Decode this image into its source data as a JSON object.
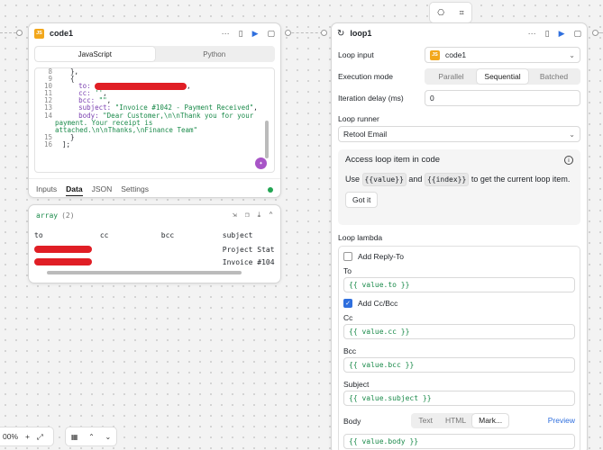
{
  "code_card": {
    "title": "code1",
    "badge": "JS",
    "tabs": [
      "JavaScript",
      "Python"
    ],
    "lines": [
      "8",
      "9",
      "10",
      "11",
      "12",
      "13",
      "14",
      "",
      "",
      "15",
      "16"
    ],
    "code": {
      "l8": "  },",
      "l9": "  {",
      "to_key": "to:",
      "to_tail": ",",
      "cc_key": "cc:",
      "cc_val": "''",
      "cc_tail": ",",
      "bcc_key": "bcc:",
      "bcc_val": "\"\"",
      "bcc_tail": ",",
      "subject_key": "subject:",
      "subject_val": "\"Invoice #1042 - Payment Received\"",
      "subject_tail": ",",
      "body_key": "body:",
      "body_val1": "\"Dear Customer,\\n\\nThank you for your",
      "body_val2": "payment. Your receipt is",
      "body_val3": "attached.\\n\\nThanks,\\nFinance Team\"",
      "l15": "  }",
      "l16": "];"
    },
    "subtabs": [
      "Inputs",
      "Data",
      "JSON",
      "Settings"
    ]
  },
  "result_card": {
    "label": "array",
    "count": "(2)",
    "columns": [
      "to",
      "cc",
      "bcc",
      "subject"
    ],
    "rows": [
      {
        "subject": "Project Stat"
      },
      {
        "subject": "Invoice #104"
      }
    ]
  },
  "loop_card": {
    "title": "loop1",
    "loop_input_label": "Loop input",
    "loop_input_value": "code1",
    "execution_mode_label": "Execution mode",
    "execution_modes": [
      "Parallel",
      "Sequential",
      "Batched"
    ],
    "iteration_delay_label": "Iteration delay (ms)",
    "iteration_delay_value": "0",
    "loop_runner_label": "Loop runner",
    "loop_runner_value": "Retool Email",
    "info": {
      "title": "Access loop item in code",
      "use": "Use",
      "pill1": "{{value}}",
      "and": "and",
      "pill2": "{{index}}",
      "rest": "to get the current loop item.",
      "button": "Got it"
    },
    "lambda_label": "Loop lambda",
    "add_reply_to": "Add Reply-To",
    "to_label": "To",
    "to_expr": "value.to",
    "add_cc_bcc": "Add Cc/Bcc",
    "cc_label": "Cc",
    "cc_expr": "value.cc",
    "bcc_label": "Bcc",
    "bcc_expr": "value.bcc",
    "subject_label": "Subject",
    "subject_expr": "value.subject",
    "body_label": "Body",
    "body_modes": [
      "Text",
      "HTML",
      "Mark..."
    ],
    "preview": "Preview",
    "body_expr": "value.body"
  },
  "zoom": {
    "value": "00%",
    "plus": "+"
  },
  "colors": {
    "accent": "#2f6fde",
    "string": "#1a8a4a",
    "redaction": "#e01e25",
    "js_badge": "#f2a71b"
  }
}
